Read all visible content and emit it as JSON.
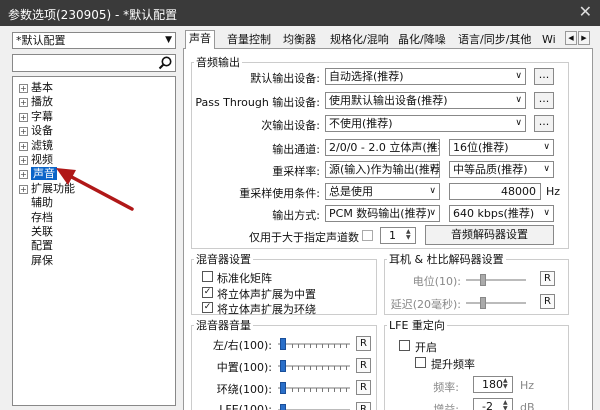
{
  "window": {
    "title": "参数选项(230905) - *默认配置",
    "close_glyph": "✕"
  },
  "sidebar": {
    "preset": "*默认配置",
    "search_value": "",
    "tree": [
      {
        "label": "基本",
        "expandable": true
      },
      {
        "label": "播放",
        "expandable": true
      },
      {
        "label": "字幕",
        "expandable": true
      },
      {
        "label": "设备",
        "expandable": true
      },
      {
        "label": "滤镜",
        "expandable": true
      },
      {
        "label": "视频",
        "expandable": true
      },
      {
        "label": "声音",
        "expandable": true,
        "selected": true
      },
      {
        "label": "扩展功能",
        "expandable": true
      },
      {
        "label": "辅助",
        "expandable": false
      },
      {
        "label": "存档",
        "expandable": false
      },
      {
        "label": "关联",
        "expandable": false
      },
      {
        "label": "配置",
        "expandable": false
      },
      {
        "label": "屏保",
        "expandable": false
      }
    ]
  },
  "tabs": [
    {
      "label": "声音",
      "active": true
    },
    {
      "label": "音量控制"
    },
    {
      "label": "均衡器"
    },
    {
      "label": "规格化/混响"
    },
    {
      "label": "晶化/降噪"
    },
    {
      "label": "语言/同步/其他"
    },
    {
      "label": "Wi"
    }
  ],
  "tab_scroll": {
    "left": "◀",
    "right": "▶"
  },
  "audio_output": {
    "legend": "音频输出",
    "default_device_label": "默认输出设备:",
    "default_device_value": "自动选择(推荐)",
    "passthrough_label": "Pass Through 输出设备:",
    "passthrough_value": "使用默认输出设备(推荐)",
    "secondary_label": "次输出设备:",
    "secondary_value": "不使用(推荐)",
    "channel_label": "输出通道:",
    "channel_value": "2/0/0 - 2.0 立体声(推荐",
    "bitdepth_value": "16位(推荐)",
    "resample_label": "重采样率:",
    "resample_value": "源(输入)作为输出(推荐",
    "quality_value": "中等品质(推荐)",
    "resample_cond_label": "重采样使用条件:",
    "resample_cond_value": "总是使用",
    "samplerate_value": "48000",
    "samplerate_unit": "Hz",
    "output_mode_label": "输出方式:",
    "output_mode_value": "PCM 数码输出(推荐)",
    "bitrate_value": "640 kbps(推荐)",
    "only_more_channels_label": "仅用于大于指定声道数",
    "channels_spinner_value": "1",
    "decoder_button": "音频解码器设置",
    "ellipsis": "..."
  },
  "mixer_settings": {
    "legend": "混音器设置",
    "standard_matrix": "标准化矩阵",
    "stereo_to_center": "将立体声扩展为中置",
    "stereo_to_surround": "将立体声扩展为环绕",
    "check": "✓"
  },
  "headphone": {
    "legend": "耳机 & 杜比解码器设置",
    "level_label": "电位(10):",
    "delay_label": "延迟(20毫秒):"
  },
  "mixer_volume": {
    "legend": "混音器音量",
    "rows": [
      {
        "label": "左/右(100):"
      },
      {
        "label": "中置(100):"
      },
      {
        "label": "环绕(100):"
      },
      {
        "label": "LFE(100):"
      }
    ],
    "reset": "R"
  },
  "lfe": {
    "legend": "LFE 重定向",
    "enable": "开启",
    "boost": "提升频率",
    "freq_label": "频率:",
    "freq_value": "180",
    "freq_unit": "Hz",
    "gain_label": "增益:",
    "gain_value": "-2",
    "gain_unit": "dB"
  }
}
